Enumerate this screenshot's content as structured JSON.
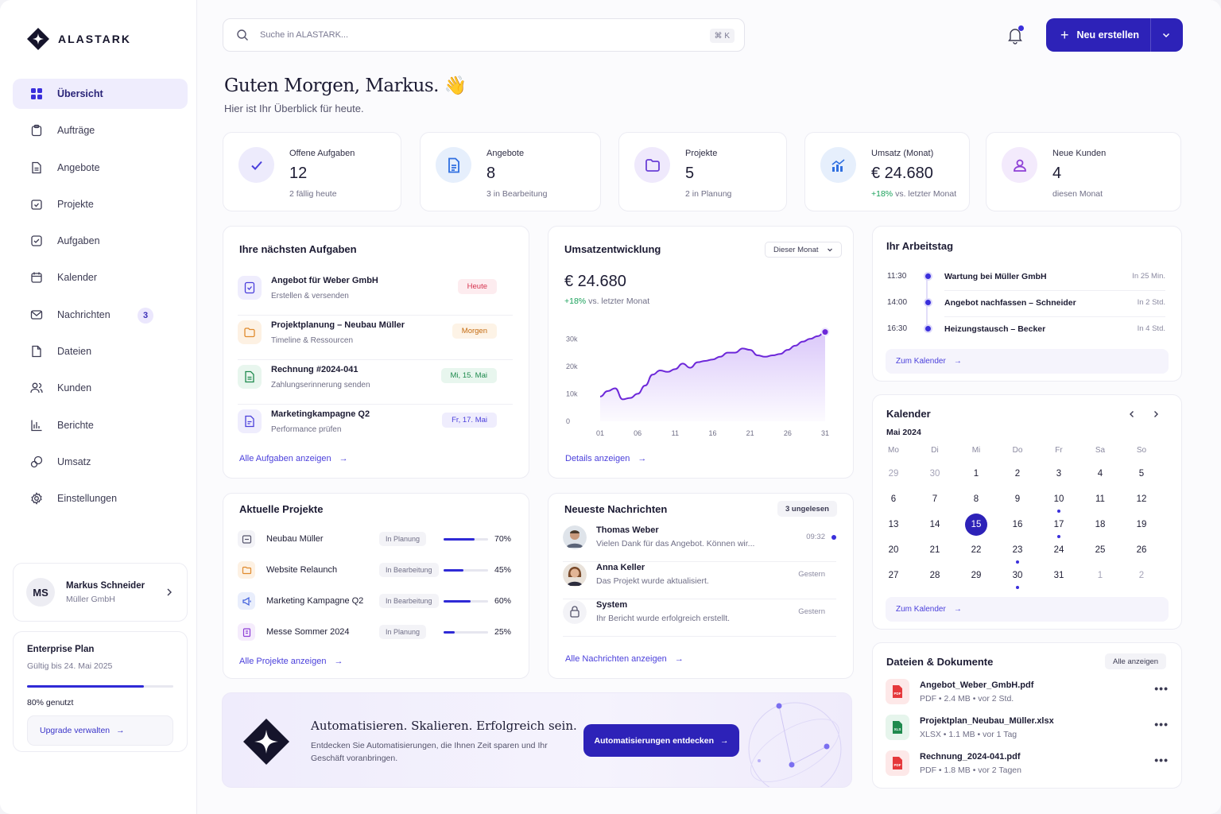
{
  "brand": {
    "name": "ALASTARK"
  },
  "sidebar": {
    "items": [
      {
        "label": "Übersicht",
        "icon": "grid-icon"
      },
      {
        "label": "Aufträge",
        "icon": "clipboard-icon"
      },
      {
        "label": "Angebote",
        "icon": "document-icon"
      },
      {
        "label": "Projekte",
        "icon": "folder-icon"
      },
      {
        "label": "Aufgaben",
        "icon": "checkbox-icon"
      },
      {
        "label": "Kalender",
        "icon": "calendar-icon"
      },
      {
        "label": "Nachrichten",
        "icon": "mail-icon",
        "badge": "3"
      },
      {
        "label": "Dateien",
        "icon": "file-icon"
      },
      {
        "label": "Kunden",
        "icon": "users-icon"
      },
      {
        "label": "Berichte",
        "icon": "chart-icon"
      },
      {
        "label": "Umsatz",
        "icon": "coins-icon"
      },
      {
        "label": "Einstellungen",
        "icon": "gear-icon"
      }
    ],
    "user": {
      "initials": "MS",
      "name": "Markus Schneider",
      "company": "Müller GmbH"
    },
    "plan": {
      "title": "Enterprise Plan",
      "valid": "Gültig bis 24. Mai 2025",
      "usage": 0.8,
      "usage_label": "80% genutzt",
      "button": "Upgrade verwalten"
    }
  },
  "header": {
    "search_placeholder": "Suche in ALASTARK...",
    "shortcut": "⌘ K",
    "new_button": "Neu erstellen",
    "greeting": "Guten Morgen, Markus. 👋",
    "subtitle": "Hier ist Ihr Überblick für heute."
  },
  "stats": [
    {
      "label": "Offene Aufgaben",
      "value": "12",
      "note": "2 fällig heute",
      "icon": "check-icon"
    },
    {
      "label": "Angebote",
      "value": "8",
      "note": "3 in Bearbeitung",
      "icon": "document-icon"
    },
    {
      "label": "Projekte",
      "value": "5",
      "note": "2 in Planung",
      "icon": "folder-icon"
    },
    {
      "label": "Umsatz (Monat)",
      "value": "€ 24.680",
      "note_highlight": "+18%",
      "note": "vs. letzter Monat",
      "icon": "trend-chart-icon"
    },
    {
      "label": "Neue Kunden",
      "value": "4",
      "note": "diesen Monat",
      "icon": "user-icon"
    }
  ],
  "tasks": {
    "title": "Ihre nächsten Aufgaben",
    "items": [
      {
        "title": "Angebot für Weber GmbH",
        "sub": "Erstellen & versenden",
        "tag": "Heute",
        "tag_color": "#d6334f",
        "tag_bg": "#fdecef",
        "icon_bg": "#efedfd",
        "icon_color": "#4a3fdb"
      },
      {
        "title": "Projektplanung – Neubau Müller",
        "sub": "Timeline & Ressourcen",
        "tag": "Morgen",
        "tag_color": "#c46a0f",
        "tag_bg": "#fdf3e6",
        "icon_bg": "#fdf1e3",
        "icon_color": "#e08a2c"
      },
      {
        "title": "Rechnung #2024-041",
        "sub": "Zahlungserinnerung senden",
        "tag": "Mi, 15. Mai",
        "tag_color": "#1e8a4d",
        "tag_bg": "#e8f6ee",
        "icon_bg": "#e8f6ee",
        "icon_color": "#1e8a4d"
      },
      {
        "title": "Marketingkampagne Q2",
        "sub": "Performance prüfen",
        "tag": "Fr, 17. Mai",
        "tag_color": "#4a3fdb",
        "tag_bg": "#efedfd",
        "icon_bg": "#efedfd",
        "icon_color": "#4a3fdb"
      }
    ],
    "link": "Alle Aufgaben anzeigen"
  },
  "revenue": {
    "title": "Umsatzentwicklung",
    "filter": "Dieser Monat",
    "value": "€ 24.680",
    "change": "+18%",
    "change_note": "vs. letzter Monat",
    "link": "Details anzeigen"
  },
  "chart_data": {
    "type": "area",
    "x": [
      1,
      2,
      3,
      4,
      5,
      6,
      7,
      8,
      9,
      10,
      11,
      12,
      13,
      14,
      15,
      16,
      17,
      18,
      19,
      20,
      21,
      22,
      23,
      24,
      25,
      26,
      27,
      28,
      29,
      30,
      31
    ],
    "values": [
      9000,
      11000,
      12000,
      8000,
      8500,
      10000,
      13000,
      17000,
      18500,
      18000,
      19000,
      21000,
      19500,
      21500,
      22000,
      22500,
      23500,
      25000,
      25000,
      26500,
      26000,
      24000,
      23500,
      24000,
      24500,
      26000,
      27500,
      29000,
      30000,
      31000,
      32500
    ],
    "xticks": [
      "01",
      "06",
      "11",
      "16",
      "21",
      "26",
      "31"
    ],
    "yticks": [
      "0",
      "10k",
      "20k",
      "30k"
    ],
    "ylim": [
      0,
      35000
    ],
    "color": "#6d28d9"
  },
  "workday": {
    "title": "Ihr Arbeitstag",
    "items": [
      {
        "time": "11:30",
        "title": "Wartung bei Müller GmbH",
        "rel": "In 25 Min."
      },
      {
        "time": "14:00",
        "title": "Angebot nachfassen – Schneider",
        "rel": "In 2 Std."
      },
      {
        "time": "16:30",
        "title": "Heizungstausch – Becker",
        "rel": "In 4 Std."
      }
    ],
    "link": "Zum Kalender"
  },
  "calendar": {
    "title": "Kalender",
    "month": "Mai 2024",
    "weekdays": [
      "Mo",
      "Di",
      "Mi",
      "Do",
      "Fr",
      "Sa",
      "So"
    ],
    "weeks": [
      [
        "29",
        "30",
        "1",
        "2",
        "3",
        "4",
        "5"
      ],
      [
        "6",
        "7",
        "8",
        "9",
        "10",
        "11",
        "12"
      ],
      [
        "13",
        "14",
        "15",
        "16",
        "17",
        "18",
        "19"
      ],
      [
        "20",
        "21",
        "22",
        "23",
        "24",
        "25",
        "26"
      ],
      [
        "27",
        "28",
        "29",
        "30",
        "31",
        "1",
        "2"
      ]
    ],
    "today": "15",
    "link": "Zum Kalender"
  },
  "projects": {
    "title": "Aktuelle Projekte",
    "items": [
      {
        "name": "Neubau Müller",
        "status": "In Planung",
        "progress": 0.7,
        "pct": "70%",
        "icon_bg": "#f3f3f7",
        "icon_color": "#55546c"
      },
      {
        "name": "Website Relaunch",
        "status": "In Bearbeitung",
        "progress": 0.45,
        "pct": "45%",
        "icon_bg": "#fdf1e3",
        "icon_color": "#e08a2c"
      },
      {
        "name": "Marketing Kampagne Q2",
        "status": "In Bearbeitung",
        "progress": 0.6,
        "pct": "60%",
        "icon_bg": "#e9eefc",
        "icon_color": "#3b5bdb"
      },
      {
        "name": "Messe Sommer 2024",
        "status": "In Planung",
        "progress": 0.25,
        "pct": "25%",
        "icon_bg": "#f5ecfc",
        "icon_color": "#8e3fd6"
      }
    ],
    "link": "Alle Projekte anzeigen"
  },
  "messages": {
    "title": "Neueste Nachrichten",
    "badge": "3 ungelesen",
    "items": [
      {
        "name": "Thomas Weber",
        "text": "Vielen Dank für das Angebot. Können wir...",
        "time": "09:32"
      },
      {
        "name": "Anna Keller",
        "text": "Das Projekt wurde aktualisiert.",
        "time": "Gestern"
      },
      {
        "name": "System",
        "text": "Ihr Bericht wurde erfolgreich erstellt.",
        "time": "Gestern"
      }
    ],
    "link": "Alle Nachrichten anzeigen"
  },
  "files": {
    "title": "Dateien & Dokumente",
    "button": "Alle anzeigen",
    "items": [
      {
        "name": "Angebot_Weber_GmbH.pdf",
        "meta": "PDF • 2.4 MB • vor 2 Std.",
        "type": "PDF",
        "color": "#e5383b"
      },
      {
        "name": "Projektplan_Neubau_Müller.xlsx",
        "meta": "XLSX • 1.1 MB • vor 1 Tag",
        "type": "XLS",
        "color": "#1e8a4d"
      },
      {
        "name": "Rechnung_2024-041.pdf",
        "meta": "PDF • 1.8 MB • vor 2 Tagen",
        "type": "PDF",
        "color": "#e5383b"
      }
    ]
  },
  "banner": {
    "title": "Automatisieren. Skalieren. Erfolgreich sein.",
    "text": "Entdecken Sie Automatisierungen, die Ihnen Zeit sparen und Ihr Geschäft voranbringen.",
    "button": "Automatisierungen entdecken"
  }
}
